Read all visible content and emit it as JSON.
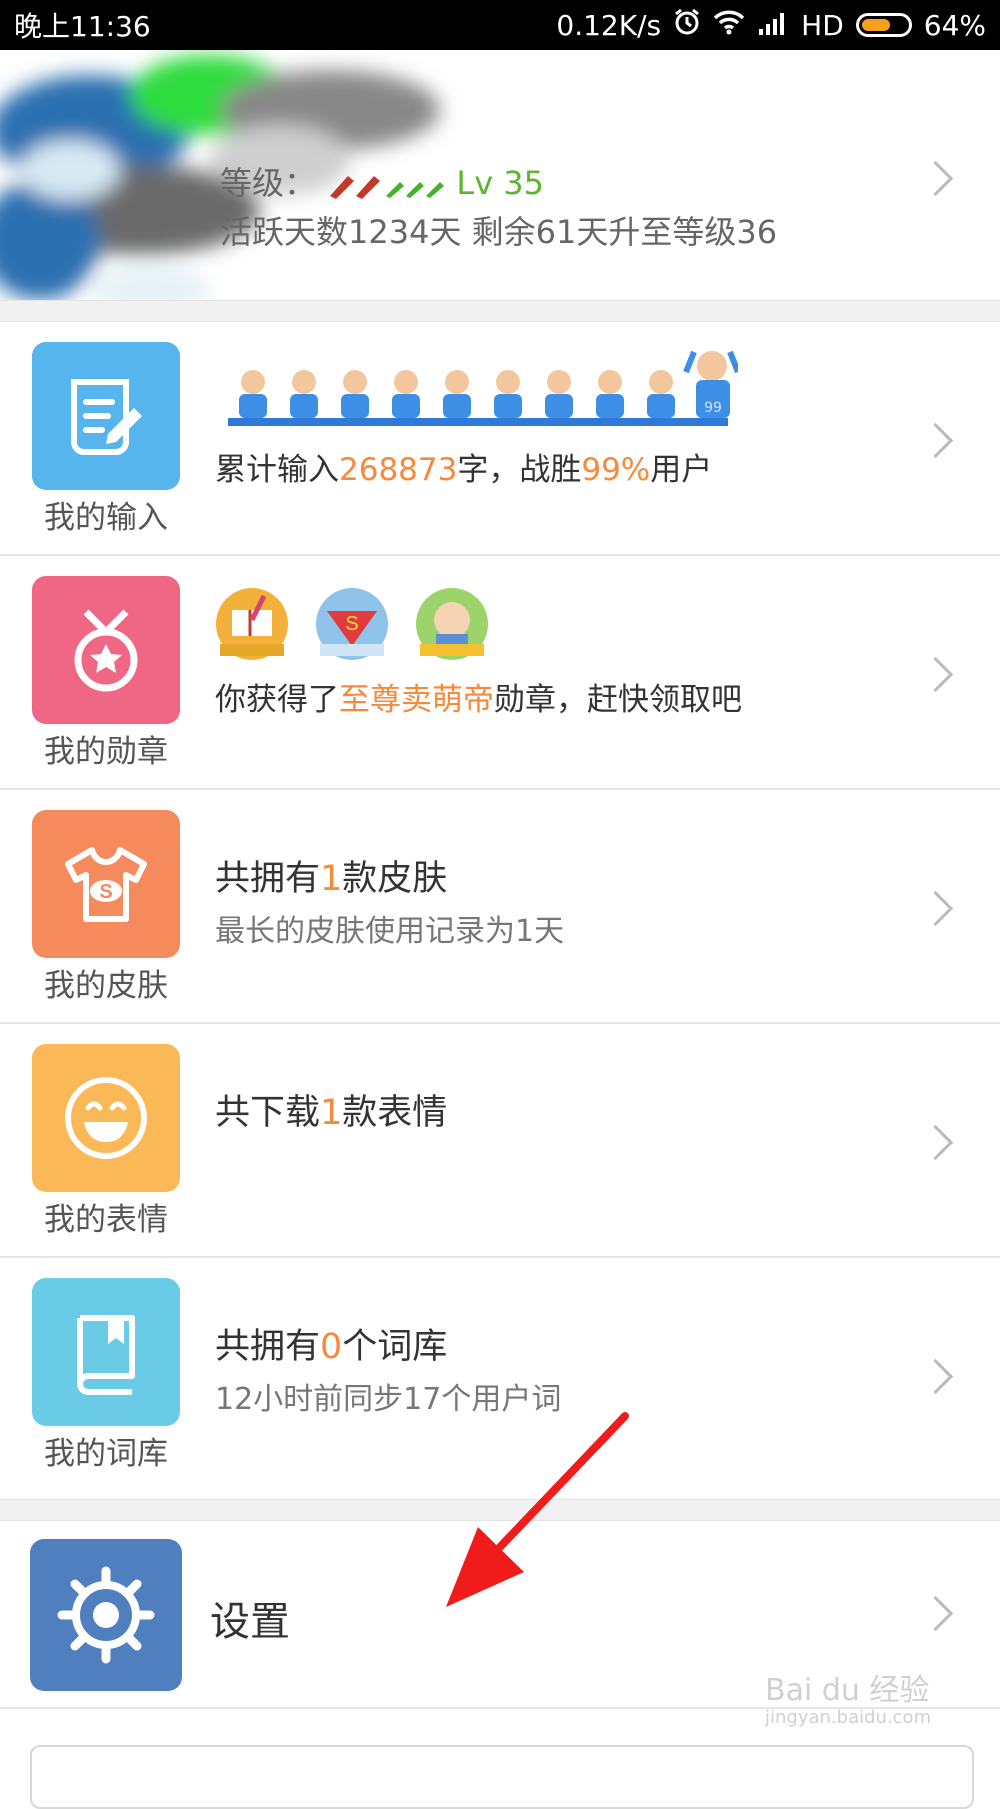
{
  "status_bar": {
    "time": "晚上11:36",
    "net_speed": "0.12K/s",
    "network": "HD",
    "battery": "64%",
    "battery_level": 0.64
  },
  "profile": {
    "level_label": "等级：",
    "level_value": "Lv 35",
    "active_days": "活跃天数1234天 剩余61天升至等级36"
  },
  "rows": {
    "input": {
      "label": "我的输入",
      "text_pre": "累计输入",
      "count": "268873",
      "text_mid": "字，战胜",
      "percent": "99%",
      "text_post": "用户",
      "rank_badge": "99"
    },
    "medal": {
      "label": "我的勋章",
      "text_pre": "你获得了",
      "medal_name": "至尊卖萌帝",
      "text_post": "勋章，赶快领取吧"
    },
    "skin": {
      "label": "我的皮肤",
      "title_pre": "共拥有",
      "count": "1",
      "title_post": "款皮肤",
      "subtitle": "最长的皮肤使用记录为1天"
    },
    "emoji": {
      "label": "我的表情",
      "title_pre": "共下载",
      "count": "1",
      "title_post": "款表情"
    },
    "dict": {
      "label": "我的词库",
      "title_pre": "共拥有",
      "count": "0",
      "title_post": "个词库",
      "subtitle": "12小时前同步17个用户词"
    }
  },
  "settings": {
    "label": "设置"
  },
  "watermark": {
    "main": "Bai du 经验",
    "sub": "jingyan.baidu.com"
  },
  "colors": {
    "input_tile": "#55b5ec",
    "medal_tile": "#f06685",
    "skin_tile": "#f58a5c",
    "emoji_tile": "#fbb856",
    "dict_tile": "#6acbe6",
    "settings_tile": "#4f7fbf",
    "highlight": "#f7893b",
    "level_green": "#5cb531"
  }
}
